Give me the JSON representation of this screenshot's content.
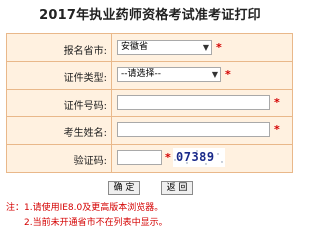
{
  "page": {
    "title": "2017年执业药师资格考试准考证打印"
  },
  "form": {
    "province": {
      "label": "报名省市:",
      "value": "安徽省"
    },
    "id_type": {
      "label": "证件类型:",
      "value": "--请选择--"
    },
    "id_number": {
      "label": "证件号码:",
      "value": ""
    },
    "name": {
      "label": "考生姓名:",
      "value": ""
    },
    "captcha": {
      "label": "验证码:",
      "value": "",
      "image_text": "07389"
    },
    "required_mark": "*"
  },
  "buttons": {
    "confirm": "确 定",
    "back": "返 回"
  },
  "notes": {
    "line1": "注：1.请使用IE8.0及更高版本浏览器。",
    "line2": "2.当前未开通省市不在列表中显示。"
  },
  "colors": {
    "form_bg": "#fff1e0",
    "border": "#e9b88a",
    "required": "#d40000",
    "note": "#d40000",
    "captcha_text": "#1a2a8a"
  }
}
